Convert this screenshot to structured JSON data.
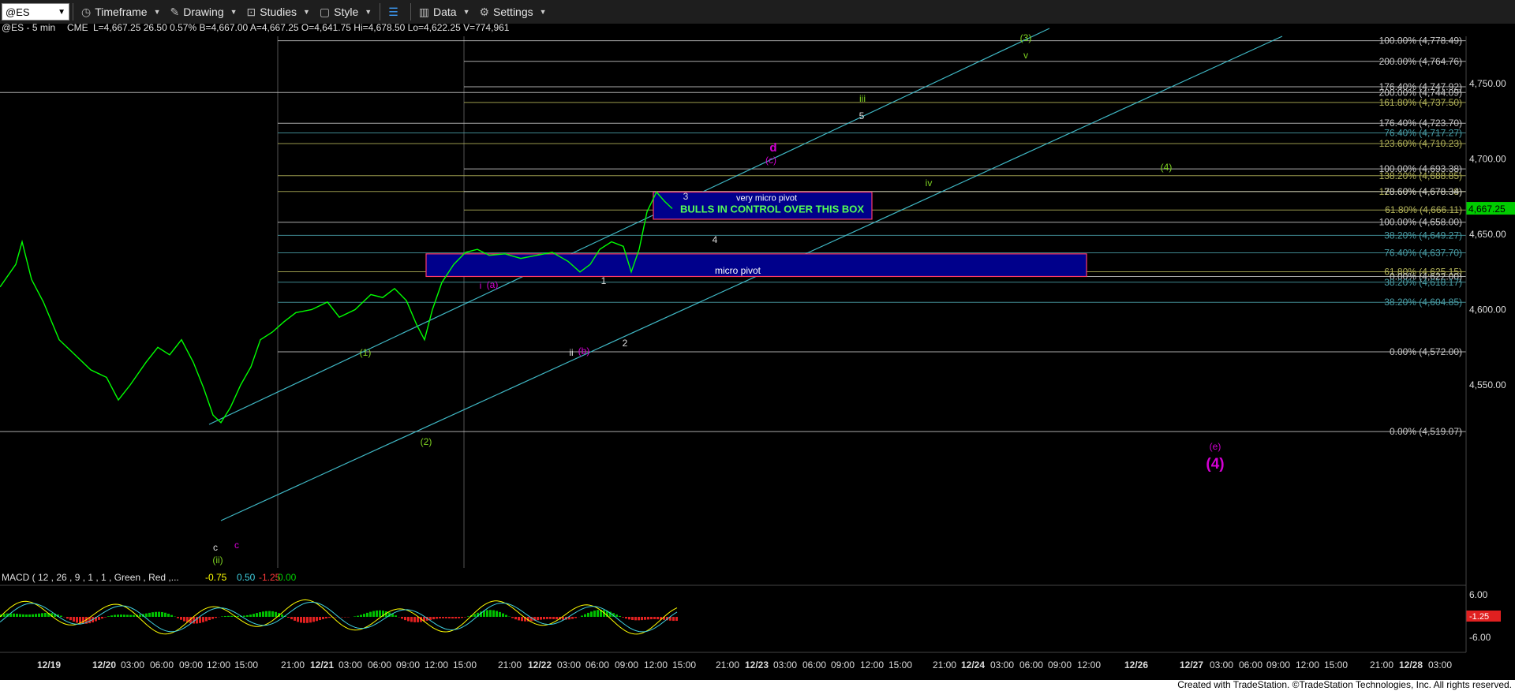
{
  "toolbar": {
    "symbol": "@ES",
    "items": [
      "Timeframe",
      "Drawing",
      "Studies",
      "Style",
      "Data",
      "Settings"
    ]
  },
  "header": {
    "symbol": "@ES - 5 min",
    "exchange": "CME",
    "quote": "L=4,667.25  26.50  0.57%  B=4,667.00  A=4,667.25  O=4,641.75  Hi=4,678.50  Lo=4,622.25  V=774,961"
  },
  "colors": {
    "background": "#000000",
    "price": "#00ff00",
    "channel": "#3fb7c4",
    "box": "#00008b",
    "box_border": "#ff3b6b",
    "wave_green": "#7ed321",
    "wave_magenta": "#d400d4",
    "fib_white": "#c8c8c8",
    "fib_olive": "#b4b45a",
    "fib_teal": "#4a9fa8"
  },
  "chart_data": {
    "type": "line",
    "title": "",
    "symbol": "@ES",
    "interval": "5 min",
    "y_axis_ticks": [
      "4,750.00",
      "4,700.00",
      "4,650.00",
      "4,600.00",
      "4,550.00"
    ],
    "ylim": [
      4503,
      4784
    ],
    "last_price": "4,667.25",
    "x_axis_ticks": [
      "12/19",
      "12/20",
      "03:00",
      "06:00",
      "09:00",
      "12:00",
      "15:00",
      "21:00",
      "12/21",
      "03:00",
      "06:00",
      "09:00",
      "12:00",
      "15:00",
      "21:00",
      "12/22",
      "03:00",
      "06:00",
      "09:00",
      "12:00",
      "15:00",
      "21:00",
      "12/23",
      "03:00",
      "06:00",
      "09:00",
      "12:00",
      "15:00",
      "21:00",
      "12/24",
      "03:00",
      "06:00",
      "09:00",
      "12:00",
      "12/26",
      "12/27",
      "03:00",
      "06:00",
      "09:00",
      "12:00",
      "15:00",
      "21:00",
      "12/28",
      "03:00"
    ],
    "fib_levels": [
      {
        "label": "100.00% (4,778.49)",
        "value": 4778.49
      },
      {
        "label": "200.00% (4,764.76)",
        "value": 4764.76
      },
      {
        "label": "176.40% (4,747.92)",
        "value": 4747.92
      },
      {
        "label": "200.00% (4,744.09)",
        "value": 4744.09
      },
      {
        "label": "161.80% (4,737.50)",
        "value": 4737.5
      },
      {
        "label": "176.40% (4,723.70)",
        "value": 4723.7
      },
      {
        "label": "76.40% (4,717.27)",
        "value": 4717.27
      },
      {
        "label": "123.60% (4,710.23)",
        "value": 4710.23
      },
      {
        "label": "100.00% (4,693.38)",
        "value": 4693.38
      },
      {
        "label": "138.20% (4,688.85)",
        "value": 4688.85
      },
      {
        "label": "123.60% (4,678.38)",
        "value": 4678.38
      },
      {
        "label": "78.60% (4,678.34)",
        "value": 4678.34
      },
      {
        "label": "61.80% (4,666.11)",
        "value": 4666.11
      },
      {
        "label": "100.00% (4,658.00)",
        "value": 4658.0
      },
      {
        "label": "38.20% (4,649.27)",
        "value": 4649.27
      },
      {
        "label": "76.40% (4,637.70)",
        "value": 4637.7
      },
      {
        "label": "61.80% (4,625.15)",
        "value": 4625.15
      },
      {
        "label": "0.00% (4,622.00)",
        "value": 4622.0
      },
      {
        "label": "38.20% (4,618.17)",
        "value": 4618.17
      },
      {
        "label": "38.20% (4,604.85)",
        "value": 4604.85
      },
      {
        "label": "0.00% (4,572.00)",
        "value": 4572.0
      },
      {
        "label": "0.00% (4,519.07)",
        "value": 4519.07
      }
    ],
    "boxes": [
      {
        "label": "very micro pivot",
        "note": "BULLS IN CONTROL OVER THIS BOX",
        "low": 4660,
        "high": 4678
      },
      {
        "label": "micro pivot",
        "low": 4622,
        "high": 4637
      }
    ],
    "wave_labels": [
      "(3)",
      "v",
      "iii",
      "5",
      "d",
      "(c)",
      "(4)",
      "iv",
      "3",
      "4",
      "i",
      "(a)",
      "1",
      "(1)",
      "ii",
      "(b)",
      "2",
      "(2)",
      "c",
      "(ii)",
      "c",
      "(e)",
      "(4)"
    ],
    "price_series": [
      {
        "x": "12/19 00:00",
        "y": 4640
      },
      {
        "x": "12/19 03:00",
        "y": 4615
      },
      {
        "x": "12/19 06:00",
        "y": 4585
      },
      {
        "x": "12/19 12:00",
        "y": 4570
      },
      {
        "x": "12/19 18:00",
        "y": 4548
      },
      {
        "x": "12/20 03:00",
        "y": 4565
      },
      {
        "x": "12/20 09:00",
        "y": 4528
      },
      {
        "x": "12/20 12:00",
        "y": 4520
      },
      {
        "x": "12/20 15:00",
        "y": 4575
      },
      {
        "x": "12/20 21:00",
        "y": 4590
      },
      {
        "x": "12/21 06:00",
        "y": 4598
      },
      {
        "x": "12/21 09:00",
        "y": 4605
      },
      {
        "x": "12/21 12:00",
        "y": 4576
      },
      {
        "x": "12/21 15:00",
        "y": 4640
      },
      {
        "x": "12/21 21:00",
        "y": 4637
      },
      {
        "x": "12/22 03:00",
        "y": 4636
      },
      {
        "x": "12/22 09:00",
        "y": 4628
      },
      {
        "x": "12/22 12:00",
        "y": 4674
      },
      {
        "x": "12/22 15:00",
        "y": 4667.25
      }
    ],
    "macd": {
      "label": "MACD ( 12 , 26 , 9 , 1 , 1 , Green , Red ,...",
      "values": [
        "-0.75",
        "0.50",
        "-1.25",
        "0.00"
      ],
      "value_colors": [
        "#ffff00",
        "#3fd0e0",
        "#ff3b3b",
        "#00d000"
      ],
      "y_ticks": [
        "6.00",
        "-6.00"
      ],
      "last_label": "-1.25"
    }
  },
  "footer": "Created with TradeStation. ©TradeStation Technologies, Inc. All rights reserved."
}
